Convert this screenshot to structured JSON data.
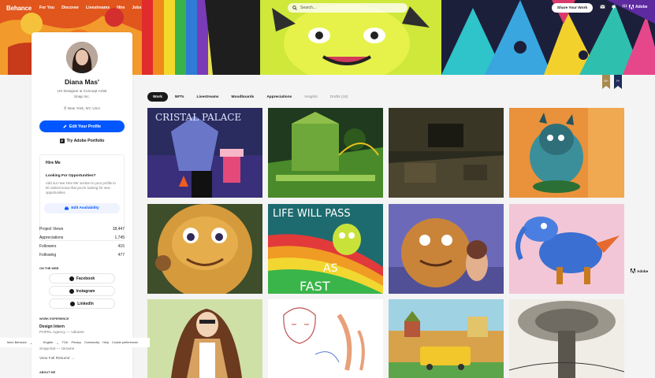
{
  "nav": {
    "logo": "Behance",
    "links": [
      "For You",
      "Discover",
      "Livestreams",
      "Hire",
      "Jobs"
    ],
    "search_placeholder": "Search...",
    "share_label": "Share Your Work",
    "adobe_label": "Adobe",
    "icons": [
      "mail-icon",
      "bell-icon",
      "avatar-icon"
    ]
  },
  "profile": {
    "name": "Diana Mas'",
    "title": "UX Designer & Concept Artist",
    "company": "Snap Inc.",
    "location": "New York, NY, USA",
    "edit_label": "Edit Your Profile",
    "try_label": "Try Adobe Portfolio",
    "hire": {
      "title": "Hire Me",
      "question": "Looking For Opportunities?",
      "desc": "Add our new 'Hire Me' section to your profile to let visitors know that you're looking for new opportunities.",
      "button": "Edit Availability"
    },
    "stats": [
      {
        "label": "Project Views",
        "value": "18,447"
      },
      {
        "label": "Appreciations",
        "value": "1,745"
      },
      {
        "label": "Followers",
        "value": "415"
      },
      {
        "label": "Following",
        "value": "477"
      }
    ],
    "on_web_title": "ON THE WEB",
    "social": [
      "Facebook",
      "Instagram",
      "LinkedIn"
    ],
    "work_exp_title": "WORK EXPERIENCE",
    "job_title": "Design Intern",
    "job_company": "POPEL Agency — Ukraine",
    "job2_company": "Snapchat — Ukraine",
    "view_full": "View Full Résumé",
    "about_title": "ABOUT ME"
  },
  "footer": {
    "items": [
      "More Behance",
      "English",
      "TOU",
      "Privacy",
      "Community",
      "Help",
      "Cookie preferences"
    ]
  },
  "tabs": [
    {
      "label": "Work",
      "active": true
    },
    {
      "label": "NFTs"
    },
    {
      "label": "Livestreams"
    },
    {
      "label": "Moodboards"
    },
    {
      "label": "Appreciations"
    },
    {
      "label": "Insights",
      "muted": true
    },
    {
      "label": "Drafts (18)",
      "muted": true
    }
  ],
  "ribbons": [
    {
      "label": "30+",
      "color": "#a88a4e"
    },
    {
      "label": "Pr",
      "color": "#1f2b5a"
    }
  ],
  "adobe_side": "Adobe",
  "projects": [
    {
      "name": "project-crystal-palace",
      "text": "CRISTAL PALACE"
    },
    {
      "name": "project-green-garden"
    },
    {
      "name": "project-dark-interior"
    },
    {
      "name": "project-blue-creature"
    },
    {
      "name": "project-yellow-monster"
    },
    {
      "name": "project-life-will-pass",
      "text_top": "LIFE WILL PASS",
      "text_mid": "AS",
      "text_bot": "FAST"
    },
    {
      "name": "project-monster-and-girl"
    },
    {
      "name": "project-blue-dragon"
    },
    {
      "name": "project-lady-coat"
    },
    {
      "name": "project-sketch-girl"
    },
    {
      "name": "project-bus-town"
    },
    {
      "name": "project-ink-tree"
    }
  ]
}
